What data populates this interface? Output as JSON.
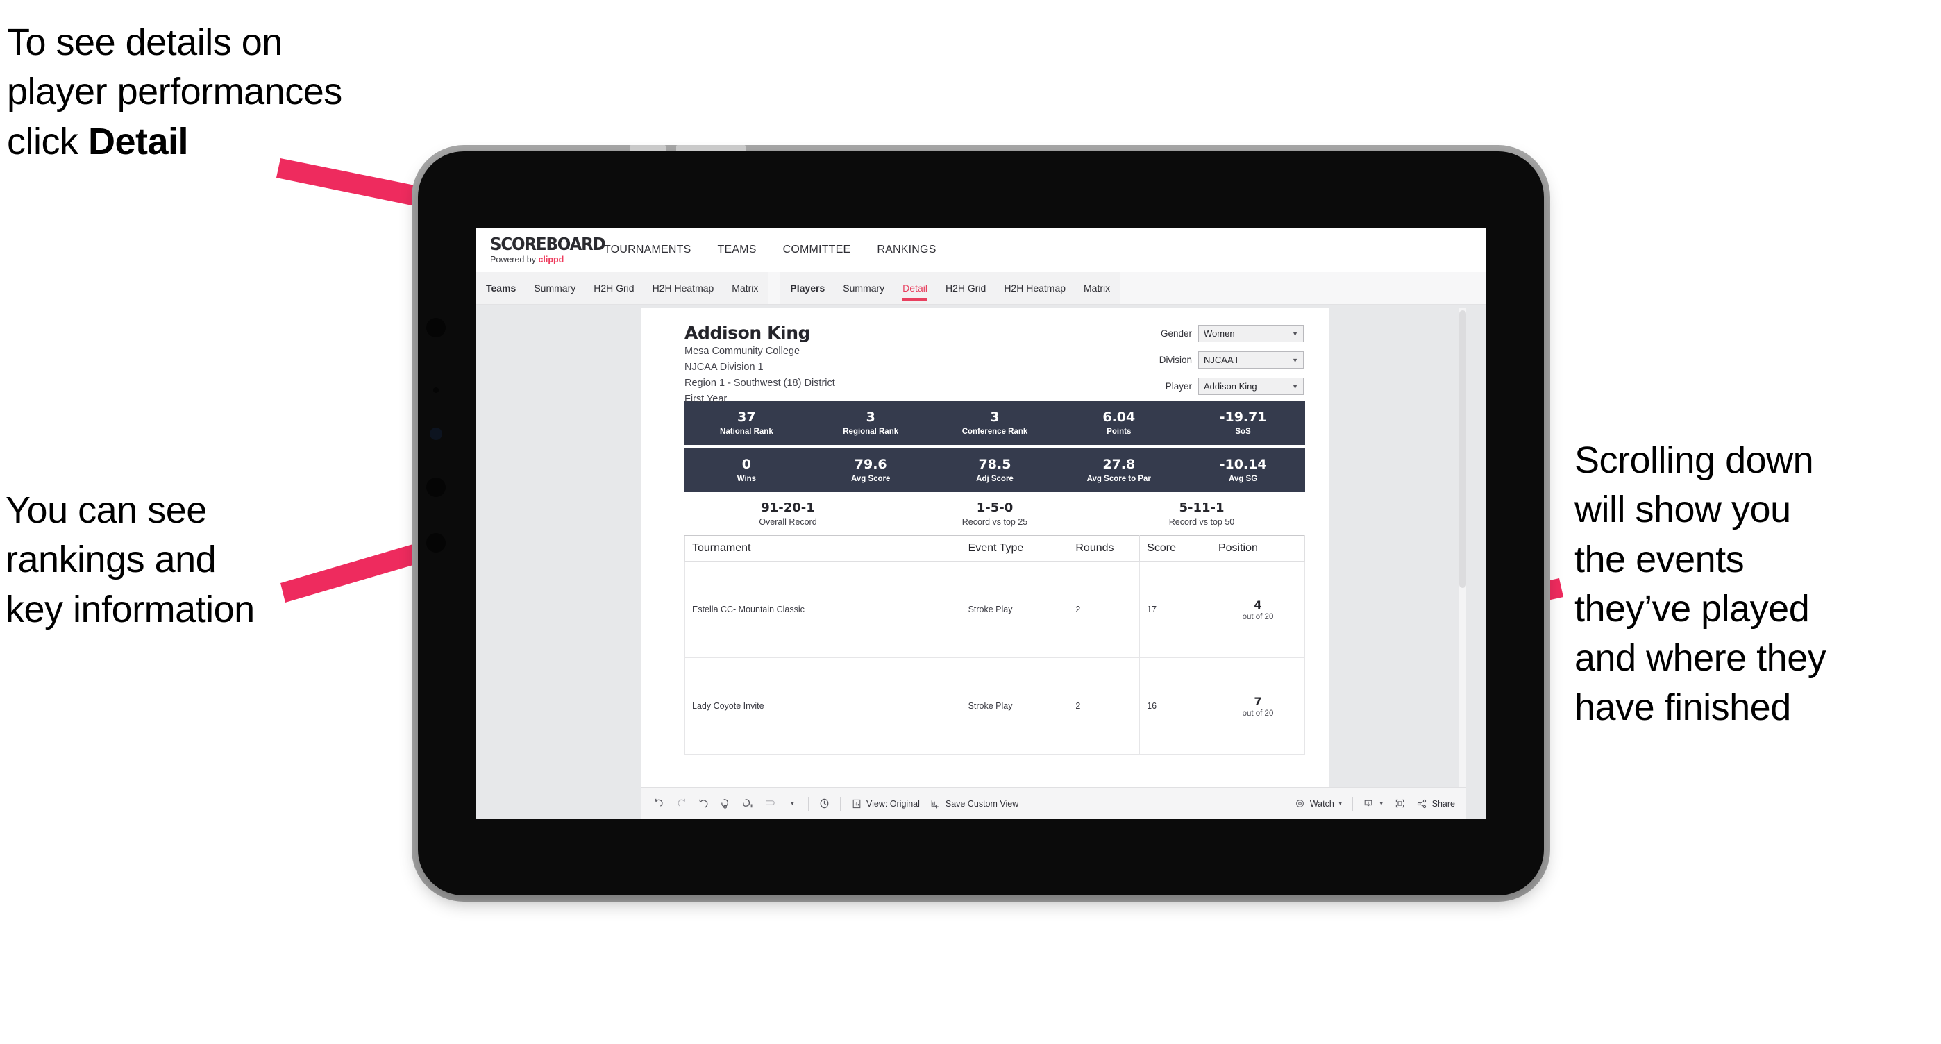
{
  "annotations": {
    "detail": {
      "line1": "To see details on",
      "line2": "player performances",
      "line3_pre": "click ",
      "line3_bold": "Detail"
    },
    "rankings": "You can see\nrankings and\nkey information",
    "scrolling": "Scrolling down\nwill show you\nthe events\nthey’ve played\nand where they\nhave finished"
  },
  "colors": {
    "accent": "#e8405f",
    "statbar": "#353b4d",
    "arrow": "#ee2b5e",
    "brand": "#ee3a5c"
  },
  "app": {
    "logo": {
      "title": "SCOREBOARD",
      "powered_prefix": "Powered by ",
      "brand": "clippd"
    },
    "topnav": [
      {
        "label": "TOURNAMENTS"
      },
      {
        "label": "TEAMS"
      },
      {
        "label": "COMMITTEE"
      },
      {
        "label": "RANKINGS"
      }
    ],
    "tabgroups": [
      {
        "label": "Teams",
        "tabs": [
          {
            "label": "Summary",
            "active": false
          },
          {
            "label": "H2H Grid",
            "active": false
          },
          {
            "label": "H2H Heatmap",
            "active": false
          },
          {
            "label": "Matrix",
            "active": false
          }
        ]
      },
      {
        "label": "Players",
        "tabs": [
          {
            "label": "Summary",
            "active": false
          },
          {
            "label": "Detail",
            "active": true
          },
          {
            "label": "H2H Grid",
            "active": false
          },
          {
            "label": "H2H Heatmap",
            "active": false
          },
          {
            "label": "Matrix",
            "active": false
          }
        ]
      }
    ]
  },
  "player": {
    "name": "Addison King",
    "school": "Mesa Community College",
    "division": "NJCAA Division 1",
    "region": "Region 1 - Southwest (18) District",
    "year": "First Year"
  },
  "filters": [
    {
      "label": "Gender",
      "value": "Women"
    },
    {
      "label": "Division",
      "value": "NJCAA I"
    },
    {
      "label": "Player",
      "value": "Addison King"
    }
  ],
  "stats_row1": [
    {
      "value": "37",
      "label": "National Rank"
    },
    {
      "value": "3",
      "label": "Regional Rank"
    },
    {
      "value": "3",
      "label": "Conference Rank"
    },
    {
      "value": "6.04",
      "label": "Points"
    },
    {
      "value": "-19.71",
      "label": "SoS"
    }
  ],
  "stats_row2": [
    {
      "value": "0",
      "label": "Wins"
    },
    {
      "value": "79.6",
      "label": "Avg Score"
    },
    {
      "value": "78.5",
      "label": "Adj Score"
    },
    {
      "value": "27.8",
      "label": "Avg Score to Par"
    },
    {
      "value": "-10.14",
      "label": "Avg SG"
    }
  ],
  "records": [
    {
      "value": "91-20-1",
      "label": "Overall Record"
    },
    {
      "value": "1-5-0",
      "label": "Record vs top 25"
    },
    {
      "value": "5-11-1",
      "label": "Record vs top 50"
    }
  ],
  "tournaments": {
    "headers": [
      "Tournament",
      "Event Type",
      "Rounds",
      "Score",
      "Position"
    ],
    "rows": [
      {
        "tournament": "Estella CC- Mountain Classic",
        "event_type": "Stroke Play",
        "rounds": "2",
        "score": "17",
        "position": "4",
        "out_of": "out of 20"
      },
      {
        "tournament": "Lady Coyote Invite",
        "event_type": "Stroke Play",
        "rounds": "2",
        "score": "16",
        "position": "7",
        "out_of": "out of 20"
      }
    ]
  },
  "toolbar": {
    "view_label": "View: Original",
    "save_label": "Save Custom View",
    "watch_label": "Watch",
    "share_label": "Share"
  }
}
